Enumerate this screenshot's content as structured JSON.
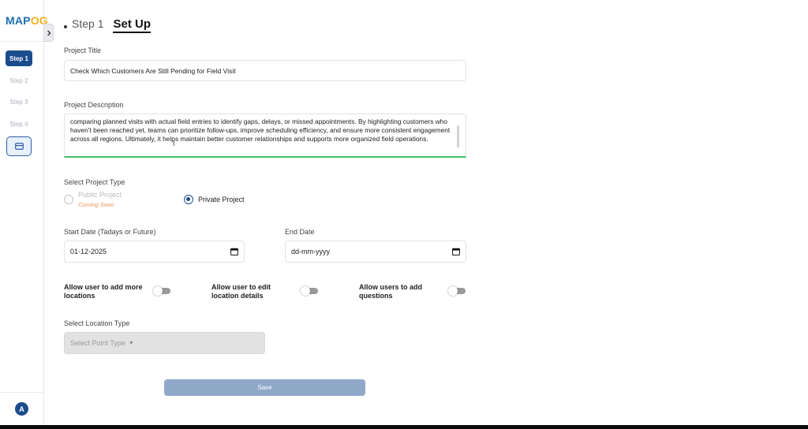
{
  "brand": {
    "logo_text_a": "MAP",
    "logo_text_b": "OG"
  },
  "sidebar": {
    "steps": [
      {
        "label": "Step 1",
        "active": true
      },
      {
        "label": "Step 2",
        "active": false
      },
      {
        "label": "Step 3",
        "active": false
      },
      {
        "label": "Step 4",
        "active": false
      }
    ],
    "extra_icon": "card-icon",
    "avatar_initial": "A"
  },
  "header": {
    "step": "Step 1",
    "title": "Set Up"
  },
  "form": {
    "project_title": {
      "label": "Project Title",
      "value": "Check Which Customers Are Still Pending for Field Visit"
    },
    "project_description": {
      "label": "Project Description",
      "value": "comparing planned visits with actual field entries to identify gaps, delays, or missed appointments. By highlighting customers who haven't been reached yet, teams can prioritize follow-ups, improve scheduling efficiency, and ensure more consistent engagement across all regions. Ultimately, it helps maintain better customer relationships and supports more organized field operations."
    },
    "project_type": {
      "label": "Select Project Type",
      "public_label": "Public Project",
      "public_note": "Coming Soon",
      "private_label": "Private Project",
      "selected": "Private Project"
    },
    "start_date": {
      "label": "Start Date (Tadays or Future)",
      "value": "01-12-2025"
    },
    "end_date": {
      "label": "End Date",
      "placeholder": "dd-mm-yyyy"
    },
    "toggles": [
      {
        "line1": "Allow user to add more",
        "line2": "locations",
        "on": false
      },
      {
        "line1": "Allow user to edit",
        "line2": "location details",
        "on": false
      },
      {
        "line1": "Allow users to add",
        "line2": "questions",
        "on": false
      }
    ],
    "location_type": {
      "label": "Select Location Type",
      "placeholder": "Select Point Type"
    },
    "save_label": "Save"
  },
  "colors": {
    "primary": "#1b4c8c",
    "accent_green": "#3fbf6a",
    "coming_soon": "#e8925a",
    "save_disabled": "#8fa8c8"
  }
}
